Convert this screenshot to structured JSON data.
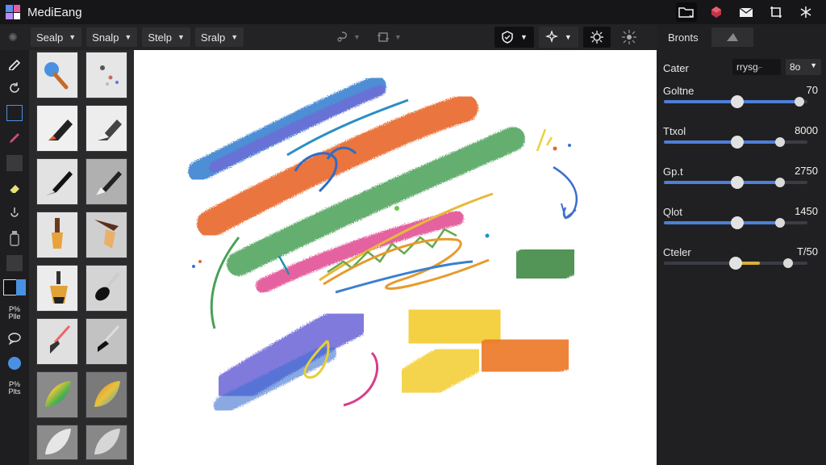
{
  "app": {
    "title": "MediEang",
    "logo_colors": [
      "#5b8ef0",
      "#e85d9f",
      "#b58cff",
      "#ffffff"
    ]
  },
  "toolbar": {
    "dropdowns": [
      {
        "label": "Sealp"
      },
      {
        "label": "Snalp"
      },
      {
        "label": "Stelp"
      },
      {
        "label": "Sralp"
      }
    ],
    "mid_icons": [
      "lasso-icon",
      "transform-icon"
    ],
    "right_icons": [
      "shield-icon",
      "sparkle-brush-icon",
      "settings-icon",
      "sun-burst-icon"
    ]
  },
  "titlebar_icons": [
    "folder-icon",
    "layer-color-icon",
    "mail-icon",
    "crop-icon",
    "asterisk-icon"
  ],
  "toolstrip": {
    "color_swatch": "#4a90e2",
    "text_label_1": "P%\nPlle",
    "text_label_2": "P%\nPlts"
  },
  "brush_panel": {
    "brushes": [
      "round-blue-brush",
      "dots-brush",
      "marker-red",
      "marker-white",
      "ink-pen-dark",
      "ink-pen-gray",
      "flat-brush-orange",
      "flat-brush-wood",
      "fan-brush-orange",
      "round-soft-brush",
      "fine-brush-red",
      "fine-brush-dark",
      "rainbow-leaf",
      "rainbow-leaf-2",
      "soft-leaf-white",
      "soft-leaf-gray"
    ]
  },
  "right_panel": {
    "tabs": [
      "Bronts",
      ""
    ],
    "cater": {
      "label": "Cater",
      "input": "rrysg",
      "select": "8o"
    },
    "sliders": [
      {
        "label": "Goltne",
        "value": "70",
        "level": 0.47
      },
      {
        "label": "Ttxol",
        "value": "8000",
        "level": 0.47
      },
      {
        "label": "Gp.t",
        "value": "2750",
        "level": 0.47
      },
      {
        "label": "Qlot",
        "value": "1450",
        "level": 0.47
      },
      {
        "label": "Cteler",
        "value": "T/50",
        "level": 0.46
      }
    ]
  }
}
